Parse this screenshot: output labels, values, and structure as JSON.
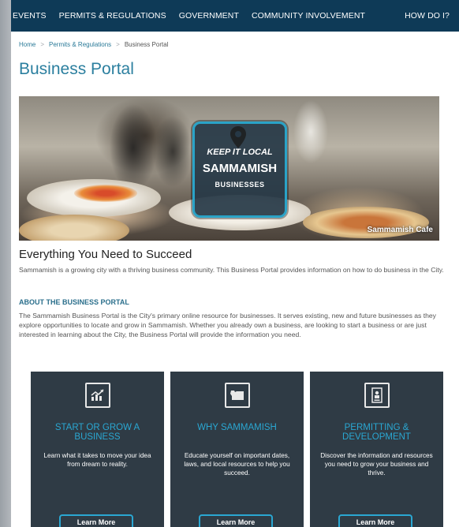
{
  "nav": {
    "items": [
      "EVENTS",
      "PERMITS & REGULATIONS",
      "GOVERNMENT",
      "COMMUNITY INVOLVEMENT",
      "HOW DO I?"
    ]
  },
  "breadcrumb": {
    "items": [
      "Home",
      "Permits & Regulations",
      "Business Portal"
    ]
  },
  "page": {
    "title": "Business Portal"
  },
  "hero": {
    "badge_line1": "KEEP IT LOCAL",
    "badge_line2": "SAMMAMISH",
    "badge_line3": "BUSINESSES",
    "caption": "Sammamish Cafe"
  },
  "intro": {
    "heading": "Everything You Need to Succeed",
    "text": "Sammamish is a growing city with a thriving business community. This Business Portal provides information on how to do business in the City."
  },
  "about": {
    "heading": "ABOUT THE BUSINESS PORTAL",
    "text": "The Sammamish Business Portal is the City's primary online resource for businesses. It serves existing, new and future businesses as they explore opportunities to locate and grow in Sammamish. Whether you already own a business, are looking to start a business or are just interested in learning about the City, the Business Portal will provide the information you need."
  },
  "cards": [
    {
      "icon": "growth-chart-icon",
      "title": "START OR GROW A BUSINESS",
      "text": "Learn what it takes to move your idea from dream to reality.",
      "button": "Learn More"
    },
    {
      "icon": "washington-map-icon",
      "title": "WHY SAMMAMISH",
      "text": "Educate yourself on important dates, laws, and local resources to help you succeed.",
      "button": "Learn More"
    },
    {
      "icon": "permit-document-icon",
      "title": "PERMITTING & DEVELOPMENT",
      "text": "Discover the information and resources you need to grow your business and thrive.",
      "button": "Learn More"
    }
  ],
  "colors": {
    "nav_bg": "#0e3a57",
    "accent": "#2b7f9f",
    "card_bg": "#2f3b45",
    "card_title": "#2aa7d2"
  }
}
